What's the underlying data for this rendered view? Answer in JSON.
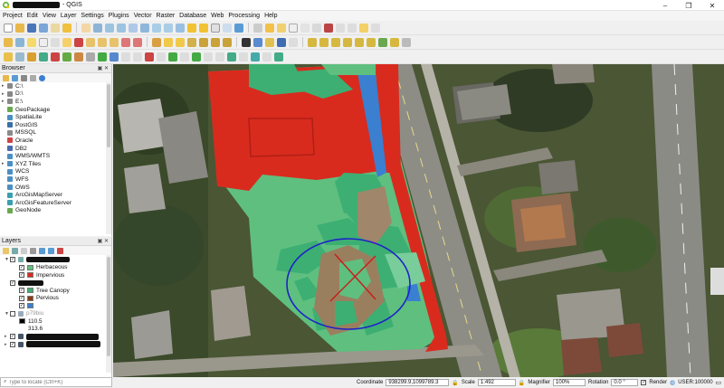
{
  "window": {
    "title": "- QGIS",
    "controls": [
      "–",
      "❐",
      "✕"
    ]
  },
  "menu": [
    "Project",
    "Edit",
    "View",
    "Layer",
    "Settings",
    "Plugins",
    "Vector",
    "Raster",
    "Database",
    "Web",
    "Processing",
    "Help"
  ],
  "browser": {
    "title": "Browser",
    "items": [
      {
        "label": "C:\\",
        "icon": "drive-icon",
        "expandable": true
      },
      {
        "label": "D:\\",
        "icon": "drive-icon",
        "expandable": true
      },
      {
        "label": "E:\\",
        "icon": "drive-icon",
        "expandable": true
      },
      {
        "label": "GeoPackage",
        "icon": "geopackage-icon",
        "expandable": false
      },
      {
        "label": "SpatiaLite",
        "icon": "spatialite-icon",
        "expandable": false
      },
      {
        "label": "PostGIS",
        "icon": "postgis-icon",
        "expandable": false
      },
      {
        "label": "MSSQL",
        "icon": "mssql-icon",
        "expandable": false
      },
      {
        "label": "Oracle",
        "icon": "oracle-icon",
        "expandable": false
      },
      {
        "label": "DB2",
        "icon": "db2-icon",
        "expandable": false
      },
      {
        "label": "WMS/WMTS",
        "icon": "wms-icon",
        "expandable": false
      },
      {
        "label": "XYZ Tiles",
        "icon": "xyz-tiles-icon",
        "expandable": true
      },
      {
        "label": "WCS",
        "icon": "wcs-icon",
        "expandable": false
      },
      {
        "label": "WFS",
        "icon": "wfs-icon",
        "expandable": false
      },
      {
        "label": "OWS",
        "icon": "ows-icon",
        "expandable": false
      },
      {
        "label": "ArcGisMapServer",
        "icon": "arcgis-map-icon",
        "expandable": false
      },
      {
        "label": "ArcGisFeatureServer",
        "icon": "arcgis-feature-icon",
        "expandable": false
      },
      {
        "label": "GeoNode",
        "icon": "geonode-icon",
        "expandable": false
      }
    ]
  },
  "layers": {
    "title": "Layers",
    "legend_a": [
      {
        "label": "Herbaceous",
        "color": "#5fbf7f"
      },
      {
        "label": "Impervious",
        "color": "#d82b1e"
      }
    ],
    "legend_b": [
      {
        "label": "Tree Canopy",
        "color": "#3daf73"
      },
      {
        "label": "Pervious",
        "color": "#8b3a10"
      },
      {
        "label": "",
        "color": "#3a7fd0"
      }
    ],
    "raster_name": "p79biu",
    "raster_values": [
      "110.5",
      "313.6"
    ]
  },
  "locator": {
    "placeholder": "Type to locate (Ctrl+K)"
  },
  "status": {
    "coordinate_label": "Coordinate",
    "coordinate_value": "938299.9,1099789.3",
    "scale_label": "Scale",
    "scale_value": "1:492",
    "magnifier_label": "Magnifier",
    "magnifier_value": "100%",
    "rotation_label": "Rotation",
    "rotation_value": "0.0 °",
    "render_label": "Render",
    "crs_label": "USER:100000"
  },
  "colors": {
    "impervious": "#d82b1e",
    "herbaceous": "#5fbf7f",
    "tree_canopy": "#3daf73",
    "water": "#3a7fd0",
    "circle": "#1e22c8",
    "cross": "#c7201b"
  }
}
